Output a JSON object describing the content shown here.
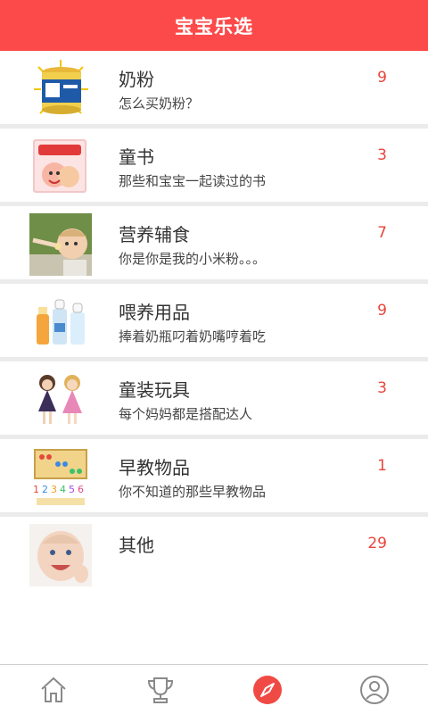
{
  "header": {
    "title": "宝宝乐选"
  },
  "categories": [
    {
      "title": "奶粉",
      "subtitle": "怎么买奶粉？",
      "count": "9",
      "icon": "milk-powder-can"
    },
    {
      "title": "童书",
      "subtitle": "那些和宝宝一起读过的书",
      "count": "3",
      "icon": "picture-book"
    },
    {
      "title": "营养辅食",
      "subtitle": "你是你是我的小米粉。。。",
      "count": "7",
      "icon": "baby-eating"
    },
    {
      "title": "喂养用品",
      "subtitle": "捧着奶瓶叼着奶嘴哼着吃",
      "count": "9",
      "icon": "baby-bottles"
    },
    {
      "title": "童装玩具",
      "subtitle": "每个妈妈都是搭配达人",
      "count": "3",
      "icon": "girls-in-dresses"
    },
    {
      "title": "早教物品",
      "subtitle": "你不知道的那些早教物品",
      "count": "1",
      "icon": "abacus-toy"
    },
    {
      "title": "其他",
      "subtitle": "",
      "count": "29",
      "icon": "smiling-baby"
    }
  ],
  "tabbar": {
    "items": [
      {
        "name": "home",
        "icon": "home-icon",
        "active": false
      },
      {
        "name": "trophy",
        "icon": "trophy-icon",
        "active": false
      },
      {
        "name": "discover",
        "icon": "compass-icon",
        "active": true
      },
      {
        "name": "profile",
        "icon": "user-icon",
        "active": false
      }
    ]
  },
  "colors": {
    "accent": "#fc4a4a",
    "count": "#e8453c",
    "divider": "#ebebeb"
  }
}
